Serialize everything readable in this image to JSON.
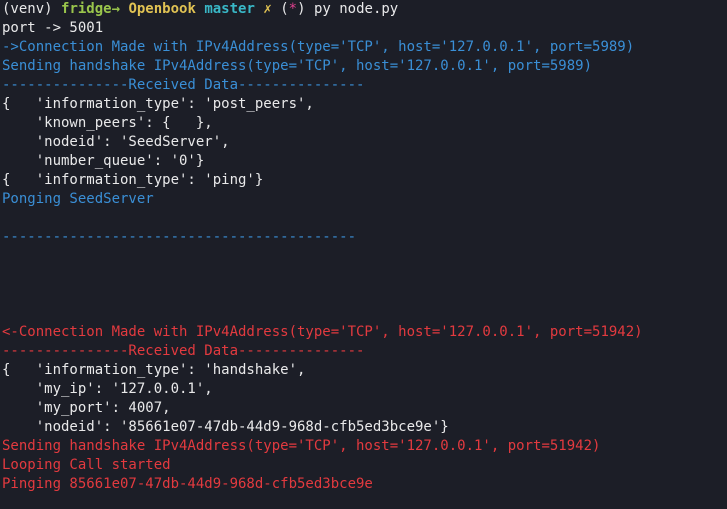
{
  "prompt": {
    "venv": "(venv) ",
    "user": "fridge",
    "arrow": "→ ",
    "dir": "Openbook",
    "branch": "master",
    "dirty": "✗",
    "open_paren": " (",
    "star": "*",
    "close_paren": ") ",
    "command": "py node.py"
  },
  "colors": {
    "background": "#1c1e27",
    "text": "#e9e9ea",
    "outgoing": "#3a8fd6",
    "incoming": "#e33a3f",
    "prompt_green": "#9ac54c",
    "branch_cyan": "#39b8c7"
  },
  "output_top": [
    "port -> 5001"
  ],
  "blue_block": [
    "->Connection Made with IPv4Address(type='TCP', host='127.0.0.1', port=5989)",
    "Sending handshake IPv4Address(type='TCP', host='127.0.0.1', port=5989)",
    "---------------Received Data---------------"
  ],
  "white_block_1": [
    "{   'information_type': 'post_peers',",
    "    'known_peers': {   },",
    "    'nodeid': 'SeedServer',",
    "    'number_queue': '0'}",
    "{   'information_type': 'ping'}"
  ],
  "blue_tail": [
    "Ponging SeedServer",
    "",
    "------------------------------------------"
  ],
  "red_block": [
    "<-Connection Made with IPv4Address(type='TCP', host='127.0.0.1', port=51942)",
    "---------------Received Data---------------"
  ],
  "white_block_2": [
    "{   'information_type': 'handshake',",
    "    'my_ip': '127.0.0.1',",
    "    'my_port': 4007,",
    "    'nodeid': '85661e07-47db-44d9-968d-cfb5ed3bce9e'}"
  ],
  "red_tail": [
    "Sending handshake IPv4Address(type='TCP', host='127.0.0.1', port=51942)",
    "Looping Call started",
    "Pinging 85661e07-47db-44d9-968d-cfb5ed3bce9e",
    "",
    "------------------------------------------"
  ]
}
